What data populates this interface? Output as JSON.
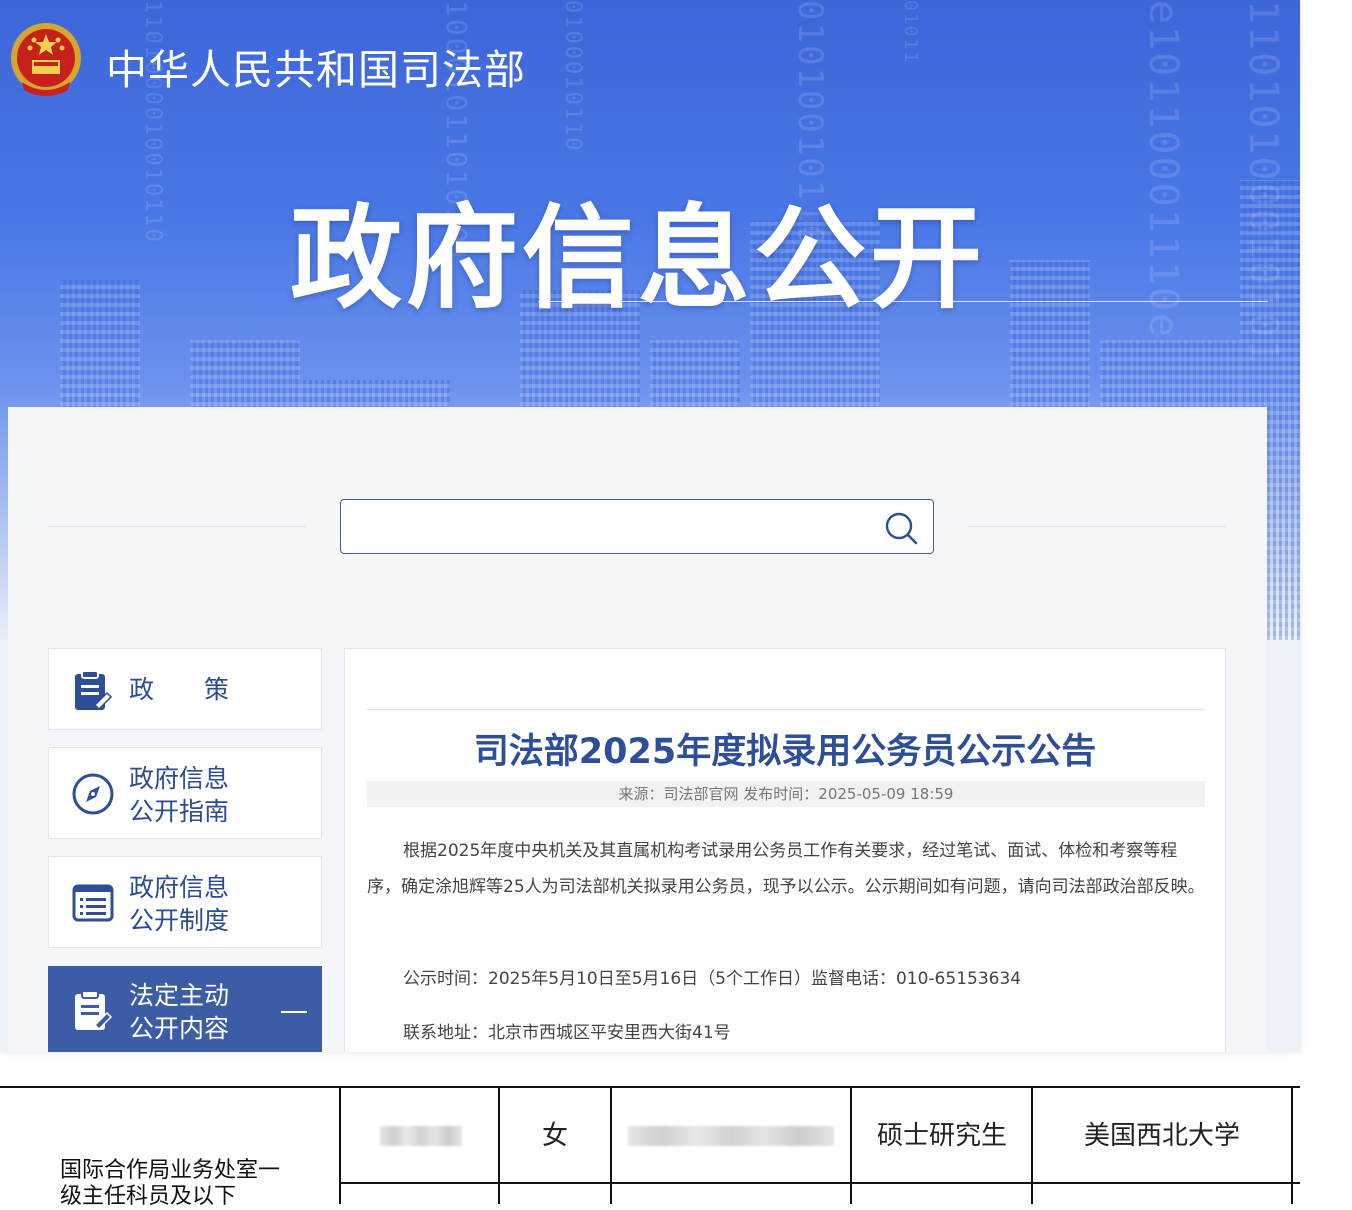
{
  "header": {
    "ministry_name": "中华人民共和国司法部",
    "banner_title": "政府信息公开"
  },
  "search": {
    "value": "",
    "placeholder": ""
  },
  "sidebar": {
    "items": [
      {
        "label_line1": "政　　策",
        "label_line2": "",
        "icon": "document-edit-icon",
        "active": false
      },
      {
        "label_line1": "政府信息",
        "label_line2": "公开指南",
        "icon": "compass-icon",
        "active": false
      },
      {
        "label_line1": "政府信息",
        "label_line2": "公开制度",
        "icon": "list-document-icon",
        "active": false
      },
      {
        "label_line1": "法定主动",
        "label_line2": "公开内容",
        "icon": "document-edit-icon",
        "active": true,
        "expand_symbol": "—"
      }
    ]
  },
  "article": {
    "title": "司法部2025年度拟录用公务员公示公告",
    "meta": "来源：司法部官网 发布时间：2025-05-09 18:59",
    "paragraph1": "根据2025年度中央机关及其直属机构考试录用公务员工作有关要求，经过笔试、面试、体检和考察等程序，确定涂旭辉等25人为司法部机关拟录用公务员，现予以公示。公示期间如有问题，请向司法部政治部反映。",
    "paragraph2": "公示时间：2025年5月10日至5月16日（5个工作日）监督电话：010-65153634",
    "paragraph3": "联系地址：北京市西城区平安里西大街41号"
  },
  "table": {
    "department": "国际合作局业务处室一级主任科员及以下",
    "row": {
      "gender": "女",
      "education": "硕士研究生",
      "school": "美国西北大学"
    }
  },
  "colors": {
    "banner_blue": "#4b78e6",
    "accent_navy": "#2d4e98",
    "active_nav": "#3c5da6"
  }
}
